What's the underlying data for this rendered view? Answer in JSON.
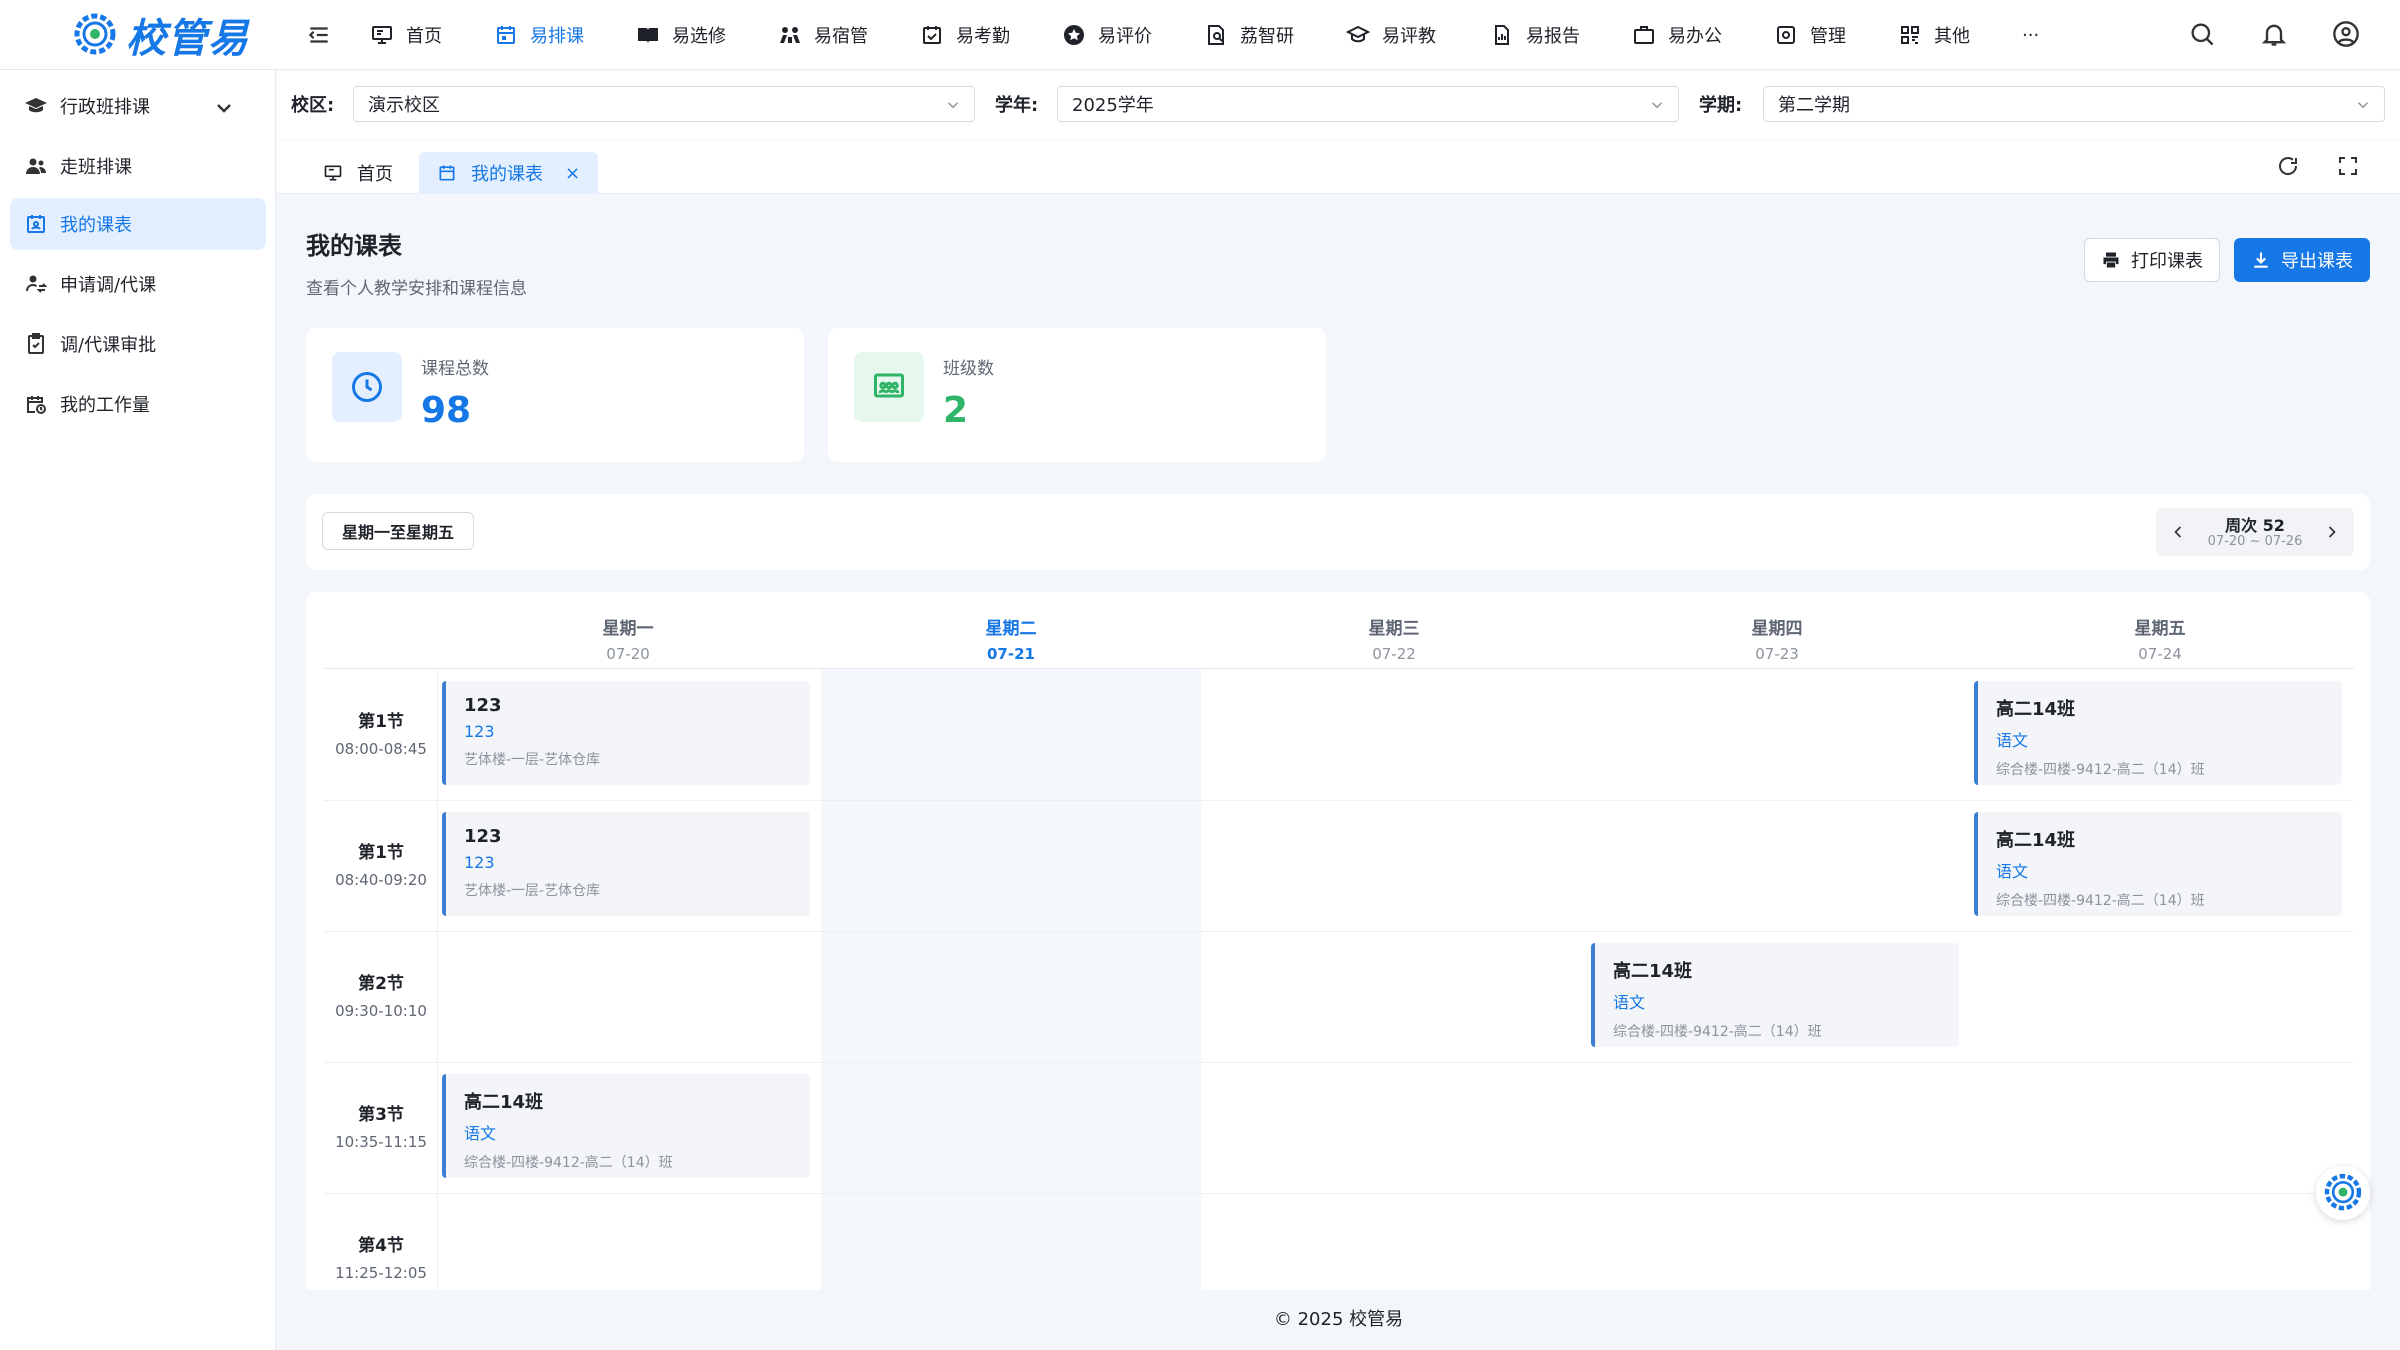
{
  "brand": {
    "name": "校管易"
  },
  "nav": [
    {
      "label": "首页",
      "icon": "monitor-icon"
    },
    {
      "label": "易排课",
      "icon": "calendar-icon",
      "active": true
    },
    {
      "label": "易选修",
      "icon": "book-icon"
    },
    {
      "label": "易宿管",
      "icon": "people-icon"
    },
    {
      "label": "易考勤",
      "icon": "calendar-check-icon"
    },
    {
      "label": "易评价",
      "icon": "star-icon"
    },
    {
      "label": "荔智研",
      "icon": "research-icon"
    },
    {
      "label": "易评教",
      "icon": "graduation-icon"
    },
    {
      "label": "易报告",
      "icon": "report-icon"
    },
    {
      "label": "易办公",
      "icon": "briefcase-icon"
    },
    {
      "label": "管理",
      "icon": "settings-icon"
    },
    {
      "label": "其他",
      "icon": "grid-icon"
    },
    {
      "label": "···",
      "icon": "more-icon"
    }
  ],
  "sidebar": {
    "items": [
      {
        "label": "行政班排课"
      },
      {
        "label": "走班排课"
      },
      {
        "label": "我的课表",
        "active": true
      },
      {
        "label": "申请调/代课"
      },
      {
        "label": "调/代课审批"
      },
      {
        "label": "我的工作量"
      }
    ]
  },
  "filters": {
    "campus_label": "校区:",
    "campus_value": "演示校区",
    "year_label": "学年:",
    "year_value": "2025学年",
    "term_label": "学期:",
    "term_value": "第二学期"
  },
  "tabs": [
    {
      "label": "首页"
    },
    {
      "label": "我的课表",
      "active": true,
      "close": "×"
    }
  ],
  "page": {
    "title": "我的课表",
    "subtitle": "查看个人教学安排和课程信息",
    "print_label": "打印课表",
    "export_label": "导出课表"
  },
  "stats": [
    {
      "label": "课程总数",
      "value": "98",
      "color": "#1677e6"
    },
    {
      "label": "班级数",
      "value": "2",
      "color": "#2fb468"
    }
  ],
  "week": {
    "range_label": "星期一至星期五",
    "number": "周次 52",
    "dates": "07-20 ~ 07-26"
  },
  "days": [
    {
      "name": "星期一",
      "date": "07-20"
    },
    {
      "name": "星期二",
      "date": "07-21",
      "today": true
    },
    {
      "name": "星期三",
      "date": "07-22"
    },
    {
      "name": "星期四",
      "date": "07-23"
    },
    {
      "name": "星期五",
      "date": "07-24"
    }
  ],
  "periods": [
    {
      "name": "第1节",
      "time": "08:00-08:45"
    },
    {
      "name": "第1节",
      "time": "08:40-09:20"
    },
    {
      "name": "第2节",
      "time": "09:30-10:10"
    },
    {
      "name": "第3节",
      "time": "10:35-11:15"
    },
    {
      "name": "第4节",
      "time": "11:25-12:05"
    }
  ],
  "lessons": [
    {
      "period": 0,
      "day": 0,
      "title": "123",
      "subject": "123",
      "room": "艺体楼-一层-艺体仓库"
    },
    {
      "period": 0,
      "day": 4,
      "title": "高二14班",
      "subject": "语文",
      "room": "综合楼-四楼-9412-高二（14）班"
    },
    {
      "period": 1,
      "day": 0,
      "title": "123",
      "subject": "123",
      "room": "艺体楼-一层-艺体仓库"
    },
    {
      "period": 1,
      "day": 4,
      "title": "高二14班",
      "subject": "语文",
      "room": "综合楼-四楼-9412-高二（14）班"
    },
    {
      "period": 2,
      "day": 3,
      "title": "高二14班",
      "subject": "语文",
      "room": "综合楼-四楼-9412-高二（14）班"
    },
    {
      "period": 3,
      "day": 0,
      "title": "高二14班",
      "subject": "语文",
      "room": "综合楼-四楼-9412-高二（14）班"
    }
  ],
  "footer": "© 2025 校管易",
  "colors": {
    "accent": "#1677e6",
    "green": "#2fb468"
  }
}
